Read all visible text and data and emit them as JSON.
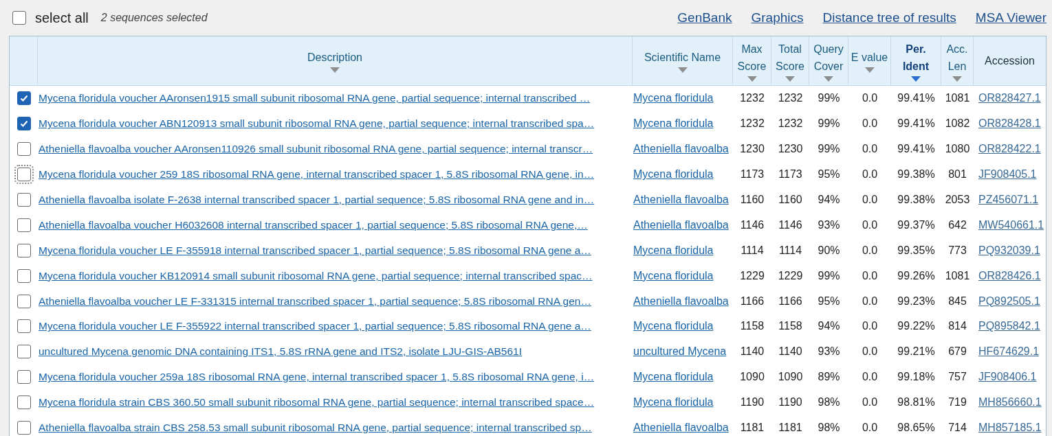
{
  "toolbar": {
    "select_all": {
      "label": "select all",
      "checked": false
    },
    "selection_count": "2 sequences selected",
    "links": [
      "GenBank",
      "Graphics",
      "Distance tree of results",
      "MSA Viewer"
    ]
  },
  "table": {
    "columns": [
      {
        "label": "Description",
        "sortable": true,
        "selected": false
      },
      {
        "label": "Scientific Name",
        "sortable": true,
        "selected": false
      },
      {
        "label": "Max Score",
        "sortable": true,
        "selected": false
      },
      {
        "label": "Total Score",
        "sortable": true,
        "selected": false
      },
      {
        "label": "Query Cover",
        "sortable": true,
        "selected": false
      },
      {
        "label": "E value",
        "sortable": true,
        "selected": false
      },
      {
        "label": "Per. Ident",
        "sortable": true,
        "selected": true
      },
      {
        "label": "Acc. Len",
        "sortable": true,
        "selected": false
      },
      {
        "label": "Accession",
        "sortable": false,
        "selected": false
      }
    ],
    "rows": [
      {
        "checked": true,
        "focused": false,
        "description": "Mycena floridula voucher AAronsen1915 small subunit ribosomal RNA gene, partial sequence; internal transcribed …",
        "scientific_name": "Mycena floridula",
        "max_score": "1232",
        "total_score": "1232",
        "query_cover": "99%",
        "e_value": "0.0",
        "per_ident": "99.41%",
        "acc_len": "1081",
        "accession": "OR828427.1"
      },
      {
        "checked": true,
        "focused": false,
        "description": "Mycena floridula voucher ABN120913 small subunit ribosomal RNA gene, partial sequence; internal transcribed spa…",
        "scientific_name": "Mycena floridula",
        "max_score": "1232",
        "total_score": "1232",
        "query_cover": "99%",
        "e_value": "0.0",
        "per_ident": "99.41%",
        "acc_len": "1082",
        "accession": "OR828428.1"
      },
      {
        "checked": false,
        "focused": false,
        "description": "Atheniella flavoalba voucher AAronsen110926 small subunit ribosomal RNA gene, partial sequence; internal transcr…",
        "scientific_name": "Atheniella flavoalba",
        "max_score": "1230",
        "total_score": "1230",
        "query_cover": "99%",
        "e_value": "0.0",
        "per_ident": "99.41%",
        "acc_len": "1080",
        "accession": "OR828422.1"
      },
      {
        "checked": false,
        "focused": true,
        "description": "Mycena floridula voucher 259 18S ribosomal RNA gene, internal transcribed spacer 1, 5.8S ribosomal RNA gene, in…",
        "scientific_name": "Mycena floridula",
        "max_score": "1173",
        "total_score": "1173",
        "query_cover": "95%",
        "e_value": "0.0",
        "per_ident": "99.38%",
        "acc_len": "801",
        "accession": "JF908405.1"
      },
      {
        "checked": false,
        "focused": false,
        "description": "Atheniella flavoalba isolate F-2638 internal transcribed spacer 1, partial sequence; 5.8S ribosomal RNA gene and in…",
        "scientific_name": "Atheniella flavoalba",
        "max_score": "1160",
        "total_score": "1160",
        "query_cover": "94%",
        "e_value": "0.0",
        "per_ident": "99.38%",
        "acc_len": "2053",
        "accession": "PZ456071.1"
      },
      {
        "checked": false,
        "focused": false,
        "description": "Atheniella flavoalba voucher H6032608 internal transcribed spacer 1, partial sequence; 5.8S ribosomal RNA gene,…",
        "scientific_name": "Atheniella flavoalba",
        "max_score": "1146",
        "total_score": "1146",
        "query_cover": "93%",
        "e_value": "0.0",
        "per_ident": "99.37%",
        "acc_len": "642",
        "accession": "MW540661.1"
      },
      {
        "checked": false,
        "focused": false,
        "description": "Mycena floridula voucher LE F-355918 internal transcribed spacer 1, partial sequence; 5.8S ribosomal RNA gene a…",
        "scientific_name": "Mycena floridula",
        "max_score": "1114",
        "total_score": "1114",
        "query_cover": "90%",
        "e_value": "0.0",
        "per_ident": "99.35%",
        "acc_len": "773",
        "accession": "PQ932039.1"
      },
      {
        "checked": false,
        "focused": false,
        "description": "Mycena floridula voucher KB120914 small subunit ribosomal RNA gene, partial sequence; internal transcribed spac…",
        "scientific_name": "Mycena floridula",
        "max_score": "1229",
        "total_score": "1229",
        "query_cover": "99%",
        "e_value": "0.0",
        "per_ident": "99.26%",
        "acc_len": "1081",
        "accession": "OR828426.1"
      },
      {
        "checked": false,
        "focused": false,
        "description": "Atheniella flavoalba voucher LE F-331315 internal transcribed spacer 1, partial sequence; 5.8S ribosomal RNA gen…",
        "scientific_name": "Atheniella flavoalba",
        "max_score": "1166",
        "total_score": "1166",
        "query_cover": "95%",
        "e_value": "0.0",
        "per_ident": "99.23%",
        "acc_len": "845",
        "accession": "PQ892505.1"
      },
      {
        "checked": false,
        "focused": false,
        "description": "Mycena floridula voucher LE F-355922 internal transcribed spacer 1, partial sequence; 5.8S ribosomal RNA gene a…",
        "scientific_name": "Mycena floridula",
        "max_score": "1158",
        "total_score": "1158",
        "query_cover": "94%",
        "e_value": "0.0",
        "per_ident": "99.22%",
        "acc_len": "814",
        "accession": "PQ895842.1"
      },
      {
        "checked": false,
        "focused": false,
        "description": "uncultured Mycena genomic DNA containing ITS1, 5.8S rRNA gene and ITS2, isolate LJU-GIS-AB561I",
        "scientific_name": "uncultured Mycena",
        "max_score": "1140",
        "total_score": "1140",
        "query_cover": "93%",
        "e_value": "0.0",
        "per_ident": "99.21%",
        "acc_len": "679",
        "accession": "HF674629.1"
      },
      {
        "checked": false,
        "focused": false,
        "description": "Mycena floridula voucher 259a 18S ribosomal RNA gene, internal transcribed spacer 1, 5.8S ribosomal RNA gene, i…",
        "scientific_name": "Mycena floridula",
        "max_score": "1090",
        "total_score": "1090",
        "query_cover": "89%",
        "e_value": "0.0",
        "per_ident": "99.18%",
        "acc_len": "757",
        "accession": "JF908406.1"
      },
      {
        "checked": false,
        "focused": false,
        "description": "Mycena floridula strain CBS 360.50 small subunit ribosomal RNA gene, partial sequence; internal transcribed space…",
        "scientific_name": "Mycena floridula",
        "max_score": "1190",
        "total_score": "1190",
        "query_cover": "98%",
        "e_value": "0.0",
        "per_ident": "98.81%",
        "acc_len": "719",
        "accession": "MH856660.1"
      },
      {
        "checked": false,
        "focused": false,
        "description": "Atheniella flavoalba strain CBS 258.53 small subunit ribosomal RNA gene, partial sequence; internal transcribed sp…",
        "scientific_name": "Atheniella flavoalba",
        "max_score": "1181",
        "total_score": "1181",
        "query_cover": "98%",
        "e_value": "0.0",
        "per_ident": "98.65%",
        "acc_len": "714",
        "accession": "MH857185.1"
      }
    ]
  }
}
